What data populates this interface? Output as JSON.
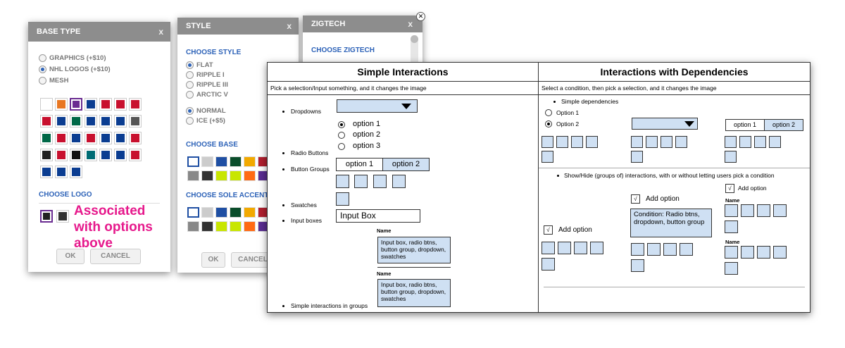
{
  "base_type_dialog": {
    "title": "BASE TYPE",
    "close": "x",
    "options": [
      "GRAPHICS (+$10)",
      "NHL LOGOS (+$10)",
      "MESH"
    ],
    "choose_logo": "CHOOSE LOGO",
    "ok": "OK",
    "cancel": "CANCEL"
  },
  "style_dialog": {
    "title": "STYLE",
    "close": "x",
    "choose_style": "CHOOSE STYLE",
    "style_options": [
      "FLAT",
      "RIPPLE I",
      "RIPPLE III",
      "ARCTIC V"
    ],
    "finish_options": [
      "NORMAL",
      "ICE (+$5)"
    ],
    "choose_base": "CHOOSE BASE",
    "choose_sole_accent": "CHOOSE SOLE ACCENT",
    "ok": "OK",
    "cancel": "CANCEL"
  },
  "zigtech_dialog": {
    "title": "ZIGTECH",
    "close": "x",
    "choose_zigtech": "CHOOSE ZIGTECH"
  },
  "annotation": {
    "line1": "Associated",
    "line2": "with options",
    "line3": "above"
  },
  "simple": {
    "title": "Simple Interactions",
    "subtitle": "Pick a selection/Input something, and it changes the image",
    "dropdowns": "Dropdowns",
    "radio_options": [
      "option 1",
      "option 2",
      "option 3"
    ],
    "radio_buttons": "Radio Buttons",
    "button_groups": "Button Groups",
    "group_options": [
      "option 1",
      "option 2"
    ],
    "swatches": "Swatches",
    "input_boxes": "Input boxes",
    "input_value": "Input Box",
    "name_label": "Name",
    "group_note": "Input box, radio btns, button group, dropdown, swatches",
    "simple_groups": "Simple interactions in groups"
  },
  "dependencies": {
    "title": "Interactions with Dependencies",
    "subtitle": "Select a condition, then pick a selection, and it changes the image",
    "simple_dependencies": "Simple dependencies",
    "radio_options": [
      "Option 1",
      "Option 2"
    ],
    "group_options": [
      "option 1",
      "option 2"
    ],
    "show_hide": "Show/Hide (groups of) interactions, with or without letting users pick a condition",
    "add_option": "Add option",
    "check_mark": "√",
    "condition_note": "Condition: Radio btns, dropdown, button group",
    "name_label": "Name"
  }
}
